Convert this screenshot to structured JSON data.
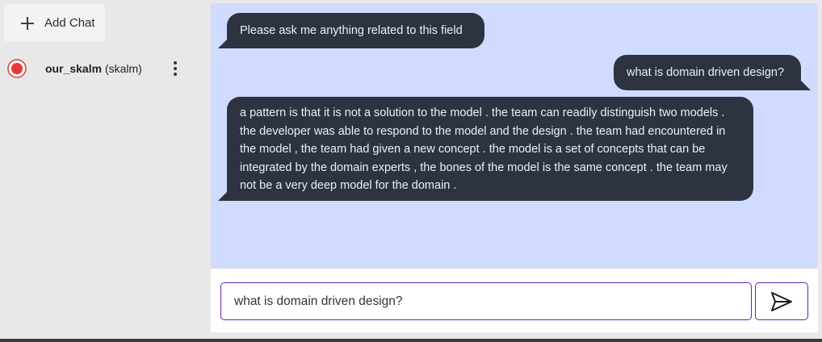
{
  "sidebar": {
    "add_chat_label": "Add Chat",
    "chats": [
      {
        "name": "our_skalm",
        "model": "(skalm)"
      }
    ]
  },
  "messages": [
    {
      "role": "bot",
      "text": "Please ask me anything related to this field"
    },
    {
      "role": "user",
      "text": "what is domain driven design?"
    },
    {
      "role": "bot",
      "text": "a pattern is that it is not a solution to the model . the team can readily distinguish two models . the developer was able to respond to the model and the design . the team had encountered in the model , the team had given a new concept . the model is a set of concepts that can be integrated by the domain experts , the bones of the model is the same concept . the team may not be a very deep model for the domain ."
    }
  ],
  "composer": {
    "value": "what is domain driven design?"
  },
  "icons": {
    "add": "plus-icon",
    "record": "record-icon",
    "menu": "more-vertical-icon",
    "send": "send-icon"
  },
  "colors": {
    "chat_background": "#d1dbff",
    "bubble": "#2d3340",
    "accent": "#6a1fb4",
    "record": "#e53935"
  }
}
